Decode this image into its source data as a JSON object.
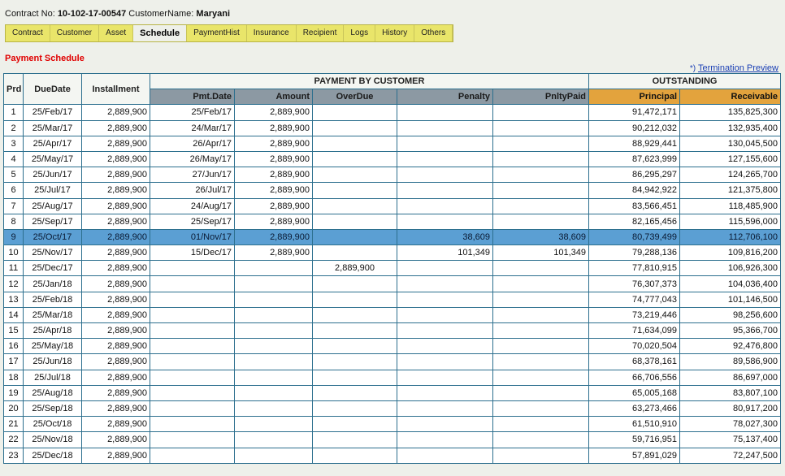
{
  "contract": {
    "no_label": "Contract No:",
    "no_value": "10-102-17-00547",
    "customer_label": "CustomerName:",
    "customer_value": "Maryani"
  },
  "tabs": [
    "Contract",
    "Customer",
    "Asset",
    "Schedule",
    "PaymentHist",
    "Insurance",
    "Recipient",
    "Logs",
    "History",
    "Others"
  ],
  "active_tab": "Schedule",
  "section_title": "Payment Schedule",
  "termination": {
    "marker": "*)",
    "link": "Termination Preview"
  },
  "table": {
    "group_payment": "PAYMENT BY CUSTOMER",
    "group_outstanding": "OUTSTANDING",
    "col_prd": "Prd",
    "col_duedate": "DueDate",
    "col_installment": "Installment",
    "col_pmtdate": "Pmt.Date",
    "col_amount": "Amount",
    "col_overdue": "OverDue",
    "col_penalty": "Penalty",
    "col_pnltypaid": "PnltyPaid",
    "col_principal": "Principal",
    "col_receivable": "Receivable",
    "selected_row": 8,
    "rows": [
      {
        "prd": "1",
        "due": "25/Feb/17",
        "inst": "2,889,900",
        "pmt": "25/Feb/17",
        "amt": "2,889,900",
        "over": "",
        "pen": "",
        "paid": "",
        "prin": "91,472,171",
        "rec": "135,825,300"
      },
      {
        "prd": "2",
        "due": "25/Mar/17",
        "inst": "2,889,900",
        "pmt": "24/Mar/17",
        "amt": "2,889,900",
        "over": "",
        "pen": "",
        "paid": "",
        "prin": "90,212,032",
        "rec": "132,935,400"
      },
      {
        "prd": "3",
        "due": "25/Apr/17",
        "inst": "2,889,900",
        "pmt": "26/Apr/17",
        "amt": "2,889,900",
        "over": "",
        "pen": "",
        "paid": "",
        "prin": "88,929,441",
        "rec": "130,045,500"
      },
      {
        "prd": "4",
        "due": "25/May/17",
        "inst": "2,889,900",
        "pmt": "26/May/17",
        "amt": "2,889,900",
        "over": "",
        "pen": "",
        "paid": "",
        "prin": "87,623,999",
        "rec": "127,155,600"
      },
      {
        "prd": "5",
        "due": "25/Jun/17",
        "inst": "2,889,900",
        "pmt": "27/Jun/17",
        "amt": "2,889,900",
        "over": "",
        "pen": "",
        "paid": "",
        "prin": "86,295,297",
        "rec": "124,265,700"
      },
      {
        "prd": "6",
        "due": "25/Jul/17",
        "inst": "2,889,900",
        "pmt": "26/Jul/17",
        "amt": "2,889,900",
        "over": "",
        "pen": "",
        "paid": "",
        "prin": "84,942,922",
        "rec": "121,375,800"
      },
      {
        "prd": "7",
        "due": "25/Aug/17",
        "inst": "2,889,900",
        "pmt": "24/Aug/17",
        "amt": "2,889,900",
        "over": "",
        "pen": "",
        "paid": "",
        "prin": "83,566,451",
        "rec": "118,485,900"
      },
      {
        "prd": "8",
        "due": "25/Sep/17",
        "inst": "2,889,900",
        "pmt": "25/Sep/17",
        "amt": "2,889,900",
        "over": "",
        "pen": "",
        "paid": "",
        "prin": "82,165,456",
        "rec": "115,596,000"
      },
      {
        "prd": "9",
        "due": "25/Oct/17",
        "inst": "2,889,900",
        "pmt": "01/Nov/17",
        "amt": "2,889,900",
        "over": "",
        "pen": "38,609",
        "paid": "38,609",
        "prin": "80,739,499",
        "rec": "112,706,100"
      },
      {
        "prd": "10",
        "due": "25/Nov/17",
        "inst": "2,889,900",
        "pmt": "15/Dec/17",
        "amt": "2,889,900",
        "over": "",
        "pen": "101,349",
        "paid": "101,349",
        "prin": "79,288,136",
        "rec": "109,816,200"
      },
      {
        "prd": "11",
        "due": "25/Dec/17",
        "inst": "2,889,900",
        "pmt": "",
        "amt": "",
        "over": "2,889,900",
        "pen": "",
        "paid": "",
        "prin": "77,810,915",
        "rec": "106,926,300"
      },
      {
        "prd": "12",
        "due": "25/Jan/18",
        "inst": "2,889,900",
        "pmt": "",
        "amt": "",
        "over": "",
        "pen": "",
        "paid": "",
        "prin": "76,307,373",
        "rec": "104,036,400"
      },
      {
        "prd": "13",
        "due": "25/Feb/18",
        "inst": "2,889,900",
        "pmt": "",
        "amt": "",
        "over": "",
        "pen": "",
        "paid": "",
        "prin": "74,777,043",
        "rec": "101,146,500"
      },
      {
        "prd": "14",
        "due": "25/Mar/18",
        "inst": "2,889,900",
        "pmt": "",
        "amt": "",
        "over": "",
        "pen": "",
        "paid": "",
        "prin": "73,219,446",
        "rec": "98,256,600"
      },
      {
        "prd": "15",
        "due": "25/Apr/18",
        "inst": "2,889,900",
        "pmt": "",
        "amt": "",
        "over": "",
        "pen": "",
        "paid": "",
        "prin": "71,634,099",
        "rec": "95,366,700"
      },
      {
        "prd": "16",
        "due": "25/May/18",
        "inst": "2,889,900",
        "pmt": "",
        "amt": "",
        "over": "",
        "pen": "",
        "paid": "",
        "prin": "70,020,504",
        "rec": "92,476,800"
      },
      {
        "prd": "17",
        "due": "25/Jun/18",
        "inst": "2,889,900",
        "pmt": "",
        "amt": "",
        "over": "",
        "pen": "",
        "paid": "",
        "prin": "68,378,161",
        "rec": "89,586,900"
      },
      {
        "prd": "18",
        "due": "25/Jul/18",
        "inst": "2,889,900",
        "pmt": "",
        "amt": "",
        "over": "",
        "pen": "",
        "paid": "",
        "prin": "66,706,556",
        "rec": "86,697,000"
      },
      {
        "prd": "19",
        "due": "25/Aug/18",
        "inst": "2,889,900",
        "pmt": "",
        "amt": "",
        "over": "",
        "pen": "",
        "paid": "",
        "prin": "65,005,168",
        "rec": "83,807,100"
      },
      {
        "prd": "20",
        "due": "25/Sep/18",
        "inst": "2,889,900",
        "pmt": "",
        "amt": "",
        "over": "",
        "pen": "",
        "paid": "",
        "prin": "63,273,466",
        "rec": "80,917,200"
      },
      {
        "prd": "21",
        "due": "25/Oct/18",
        "inst": "2,889,900",
        "pmt": "",
        "amt": "",
        "over": "",
        "pen": "",
        "paid": "",
        "prin": "61,510,910",
        "rec": "78,027,300"
      },
      {
        "prd": "22",
        "due": "25/Nov/18",
        "inst": "2,889,900",
        "pmt": "",
        "amt": "",
        "over": "",
        "pen": "",
        "paid": "",
        "prin": "59,716,951",
        "rec": "75,137,400"
      },
      {
        "prd": "23",
        "due": "25/Dec/18",
        "inst": "2,889,900",
        "pmt": "",
        "amt": "",
        "over": "",
        "pen": "",
        "paid": "",
        "prin": "57,891,029",
        "rec": "72,247,500"
      }
    ]
  },
  "colors": {
    "tab_bg": "#e9e56a",
    "selected_row": "#5b9fd3",
    "section_title": "#e00000",
    "outstanding_header": "#e3a33d",
    "payment_subheader": "#8c99a3"
  }
}
